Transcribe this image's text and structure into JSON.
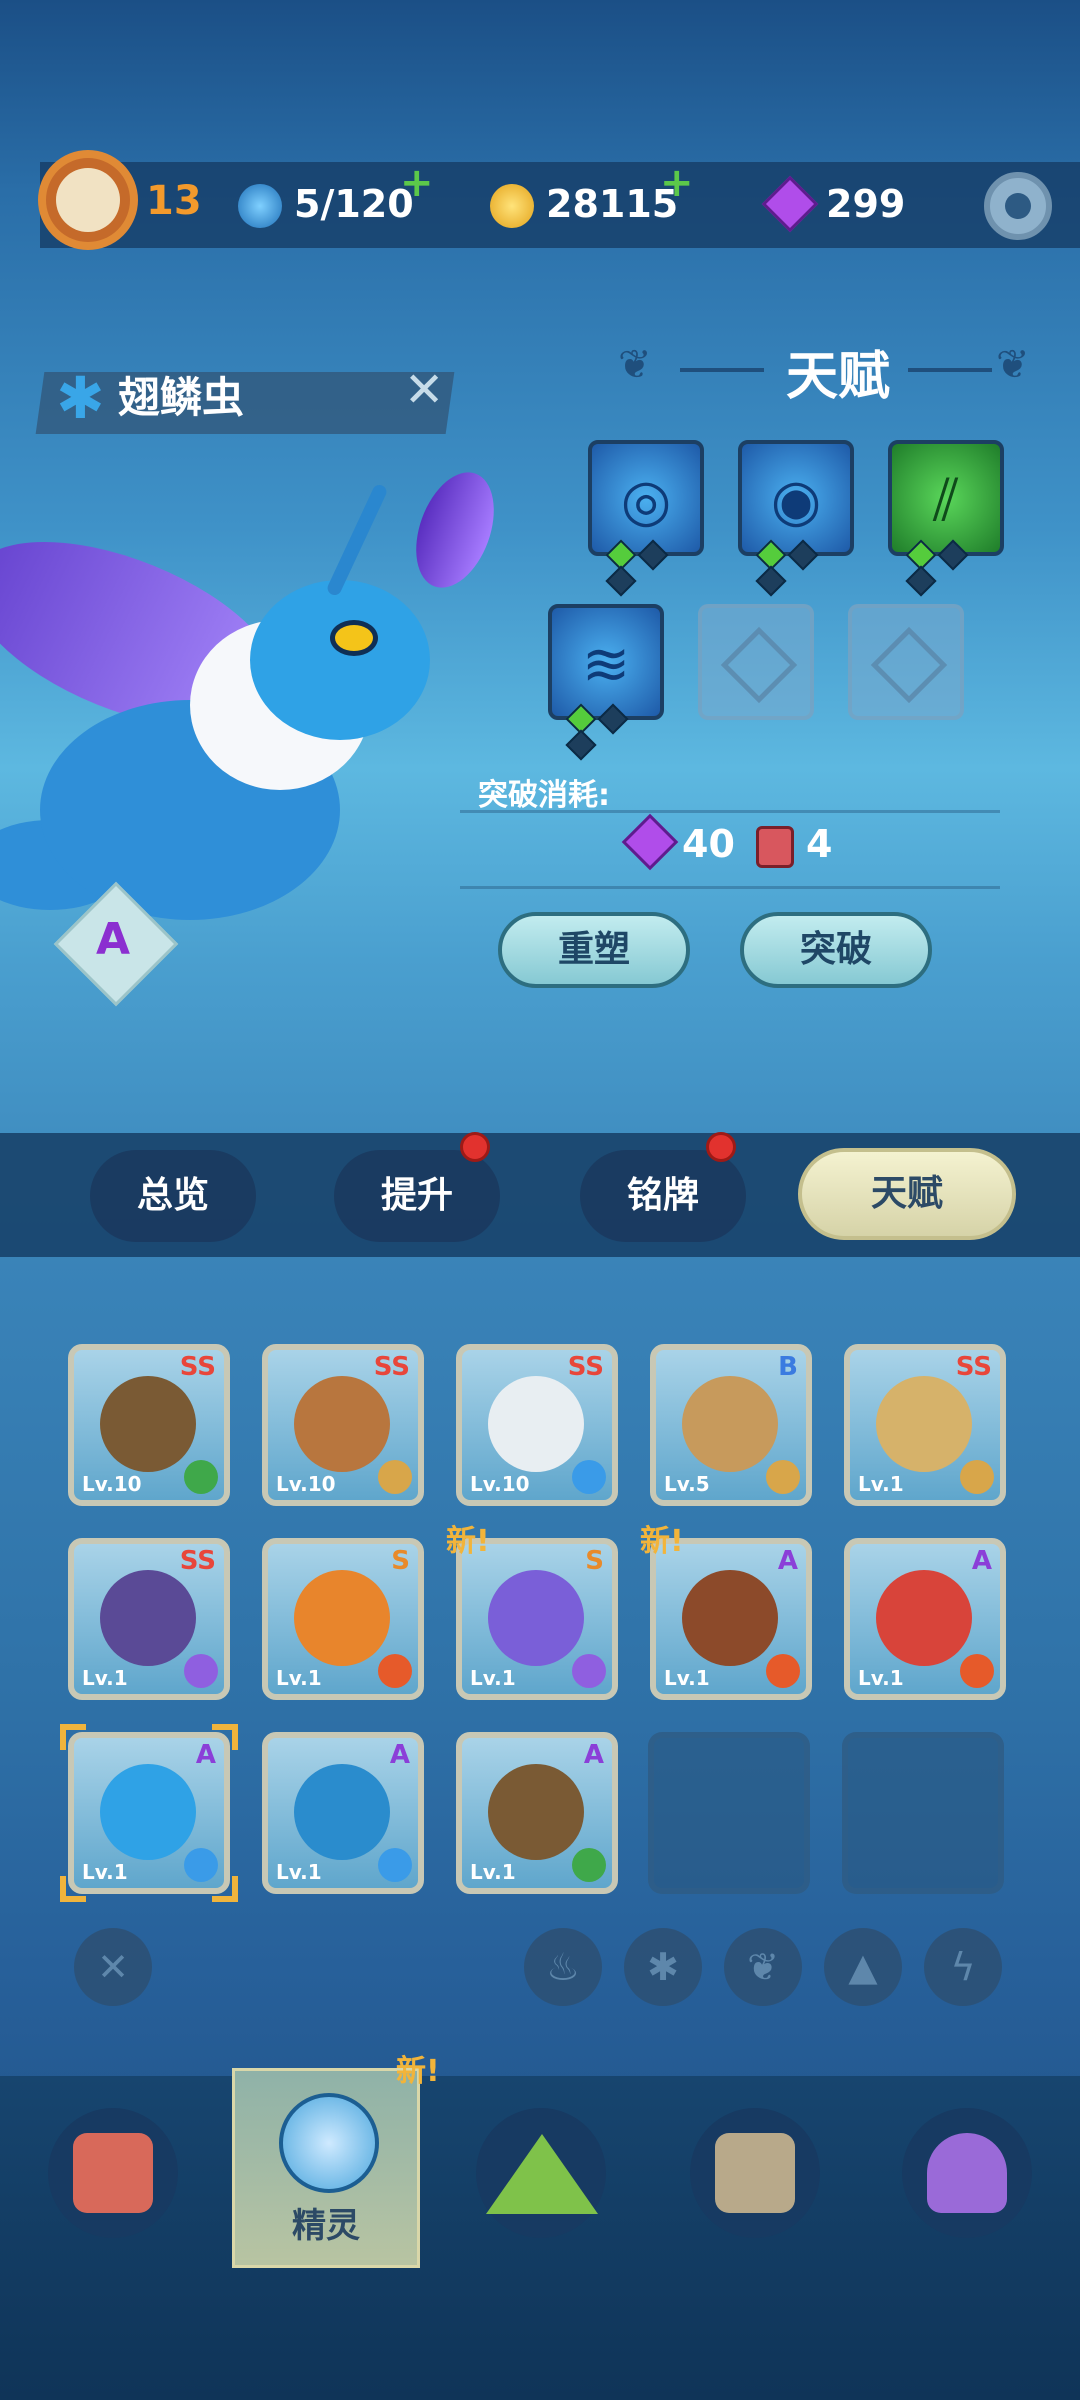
{
  "top_bar": {
    "player_level": "13",
    "water": "5/120",
    "coins": "28115",
    "gems": "299",
    "plus_symbol": "+",
    "colors": {
      "level_text": "#f39a2c",
      "plus": "#5cc84a"
    }
  },
  "spirit": {
    "name": "翅鳞虫",
    "close_symbol": "✕",
    "grade": "A",
    "element_icon": "snowflake-icon"
  },
  "talent_panel": {
    "title": "天赋",
    "slots": [
      {
        "icon": "tornado-talent-icon",
        "style": "blue",
        "symbol": "◎",
        "gems_on": 1,
        "gems_total": 3
      },
      {
        "icon": "eye-talent-icon",
        "style": "blue",
        "symbol": "◉",
        "gems_on": 1,
        "gems_total": 3
      },
      {
        "icon": "claw-talent-icon",
        "style": "green",
        "symbol": "⫽",
        "gems_on": 1,
        "gems_total": 3
      },
      {
        "icon": "wave-talent-icon",
        "style": "blue",
        "symbol": "≋",
        "gems_on": 1,
        "gems_total": 3
      },
      {
        "icon": "empty-slot-icon",
        "style": "empty"
      },
      {
        "icon": "empty-slot-icon",
        "style": "empty"
      }
    ],
    "breakthrough_cost_label": "突破消耗:",
    "cost_gem_amount": "40",
    "cost_book_amount": "4",
    "reshape_button": "重塑",
    "breakthrough_button": "突破"
  },
  "tabs": [
    {
      "label": "总览",
      "badge": false,
      "active": false
    },
    {
      "label": "提升",
      "badge": true,
      "active": false
    },
    {
      "label": "铭牌",
      "badge": true,
      "active": false
    },
    {
      "label": "天赋",
      "badge": false,
      "active": true
    }
  ],
  "spirit_grid": [
    {
      "rank": "SS",
      "level": "Lv.10",
      "element": "leaf",
      "char": "#7a5a34"
    },
    {
      "rank": "SS",
      "level": "Lv.10",
      "element": "earth",
      "char": "#b8763e"
    },
    {
      "rank": "SS",
      "level": "Lv.10",
      "element": "ice",
      "char": "#e8eef2"
    },
    {
      "rank": "B",
      "level": "Lv.5",
      "element": "earth",
      "char": "#c79a5c"
    },
    {
      "rank": "SS",
      "level": "Lv.1",
      "element": "earth",
      "char": "#d6b26a"
    },
    {
      "rank": "SS",
      "level": "Lv.1",
      "element": "lightning",
      "char": "#5a4a96"
    },
    {
      "rank": "S",
      "level": "Lv.1",
      "element": "fire",
      "char": "#e8852c"
    },
    {
      "rank": "S",
      "level": "Lv.1",
      "element": "lightning",
      "char": "#7a5fd8",
      "new": "新!"
    },
    {
      "rank": "A",
      "level": "Lv.1",
      "element": "fire",
      "char": "#8c4a2a",
      "new": "新!"
    },
    {
      "rank": "A",
      "level": "Lv.1",
      "element": "fire",
      "char": "#d8443a"
    },
    {
      "rank": "A",
      "level": "Lv.1",
      "element": "ice",
      "char": "#2fa2e6",
      "selected": true
    },
    {
      "rank": "A",
      "level": "Lv.1",
      "element": "ice",
      "char": "#2a8ccd"
    },
    {
      "rank": "A",
      "level": "Lv.1",
      "element": "leaf",
      "char": "#7a5a34"
    }
  ],
  "filters": [
    {
      "icon": "clear-filter-icon",
      "symbol": "✕"
    },
    {
      "icon": "fire-filter-icon",
      "symbol": "♨"
    },
    {
      "icon": "ice-filter-icon",
      "symbol": "✱"
    },
    {
      "icon": "leaf-filter-icon",
      "symbol": "❦"
    },
    {
      "icon": "earth-filter-icon",
      "symbol": "▲"
    },
    {
      "icon": "lightning-filter-icon",
      "symbol": "ϟ"
    }
  ],
  "bottom_nav": {
    "new_tag": "新!",
    "active_label": "精灵",
    "items": [
      {
        "icon": "device-nav-icon",
        "color": "#d8695a"
      },
      {
        "icon": "spirit-nav-icon",
        "color": "#4aa6dd"
      },
      {
        "icon": "mountain-nav-icon",
        "color": "#7fc24a"
      },
      {
        "icon": "chest-nav-icon",
        "color": "#b8a98a"
      },
      {
        "icon": "map-pin-nav-icon",
        "color": "#9a6ad8"
      }
    ]
  },
  "element_colors": {
    "leaf": "#3fa84a",
    "earth": "#d8a64a",
    "ice": "#3a9be8",
    "fire": "#e65a2a",
    "lightning": "#8f5fe0"
  },
  "rank_colors": {
    "SS": "#e8463a",
    "S": "#e88a2a",
    "A": "#8b3fd8",
    "B": "#3a7be0"
  }
}
